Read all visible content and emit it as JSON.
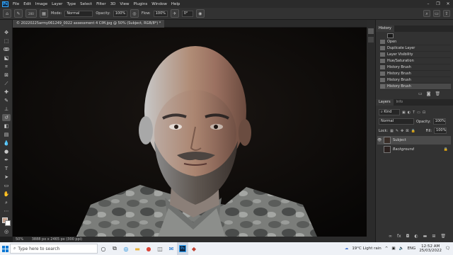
{
  "app": {
    "logo": "Ps",
    "menu": [
      "File",
      "Edit",
      "Image",
      "Layer",
      "Type",
      "Select",
      "Filter",
      "3D",
      "View",
      "Plugins",
      "Window",
      "Help"
    ]
  },
  "options": {
    "brush_size": "200",
    "mode_label": "Mode:",
    "mode_value": "Normal",
    "opacity_label": "Opacity:",
    "opacity_value": "100%",
    "flow_label": "Flow:",
    "flow_value": "100%",
    "angle_value": "0°"
  },
  "document": {
    "tab_title": "© 20220225army061249_0022 assessment 4 CIM.jpg @ 50% (Subject, RGB/8*) *",
    "zoom": "50%",
    "doc_info": "3888 px x 2465 px (300 ppi)"
  },
  "history": {
    "tab_label": "History",
    "items": [
      "Open",
      "Duplicate Layer",
      "Layer Visibility",
      "Hue/Saturation",
      "History Brush",
      "History Brush",
      "History Brush",
      "History Brush"
    ],
    "active_index": 7
  },
  "layers": {
    "tabs": [
      "Layers",
      "Info"
    ],
    "filter_label": "Kind",
    "blend_mode": "Normal",
    "opacity_label": "Opacity:",
    "opacity_value": "100%",
    "lock_label": "Lock:",
    "fill_label": "Fill:",
    "fill_value": "100%",
    "items": [
      {
        "name": "Subject",
        "selected": true
      },
      {
        "name": "Background",
        "selected": false
      }
    ]
  },
  "taskbar": {
    "search_placeholder": "Type here to search",
    "weather": "19°C  Light rain",
    "lang": "ENG",
    "time": "12:52 AM",
    "date": "25/03/2022"
  }
}
